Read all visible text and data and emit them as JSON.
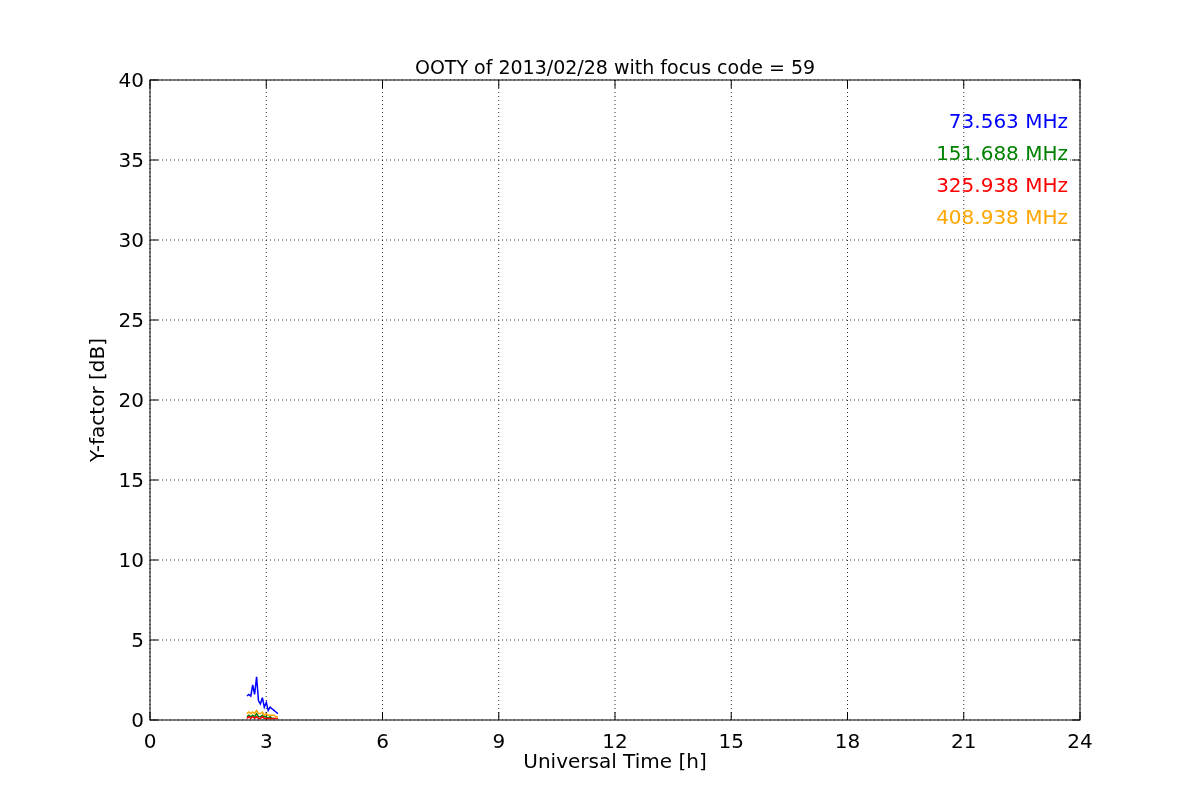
{
  "chart_data": {
    "type": "line",
    "title": "OOTY of 2013/02/28 with focus code = 59",
    "xlabel": "Universal Time [h]",
    "ylabel": "Y-factor [dB]",
    "x": [
      2.5,
      2.55,
      2.6,
      2.65,
      2.7,
      2.75,
      2.8,
      2.85,
      2.9,
      2.95,
      3.0,
      3.05,
      3.1,
      3.15,
      3.2,
      3.25,
      3.3
    ],
    "series": [
      {
        "name": "73.563 MHz",
        "color": "#0000ff",
        "values": [
          1.5,
          1.6,
          1.5,
          2.2,
          1.6,
          2.7,
          1.2,
          1.0,
          1.4,
          0.8,
          1.1,
          0.6,
          0.8,
          0.7,
          0.6,
          0.5,
          0.4
        ]
      },
      {
        "name": "151.688 MHz",
        "color": "#008000",
        "values": [
          0.2,
          0.3,
          0.2,
          0.3,
          0.2,
          0.4,
          0.2,
          0.2,
          0.3,
          0.2,
          0.2,
          0.1,
          0.2,
          0.1,
          0.1,
          null,
          null
        ]
      },
      {
        "name": "325.938 MHz",
        "color": "#ff0000",
        "values": [
          0.1,
          0.2,
          0.1,
          0.2,
          0.1,
          0.2,
          0.1,
          0.1,
          0.2,
          0.1,
          0.1,
          0.1,
          0.1,
          0.1,
          0.1,
          0.1,
          0.1
        ]
      },
      {
        "name": "408.938 MHz",
        "color": "#ffa500",
        "values": [
          0.4,
          0.5,
          0.4,
          0.5,
          0.4,
          0.6,
          0.4,
          0.4,
          0.5,
          0.3,
          0.4,
          0.3,
          0.3,
          0.3,
          0.3,
          0.2,
          0.2
        ]
      }
    ],
    "grid": true,
    "xlim": [
      0,
      24
    ],
    "ylim": [
      0,
      40
    ],
    "xticks": [
      0,
      3,
      6,
      9,
      12,
      15,
      18,
      21,
      24
    ],
    "yticks": [
      0,
      5,
      10,
      15,
      20,
      25,
      30,
      35,
      40
    ]
  }
}
